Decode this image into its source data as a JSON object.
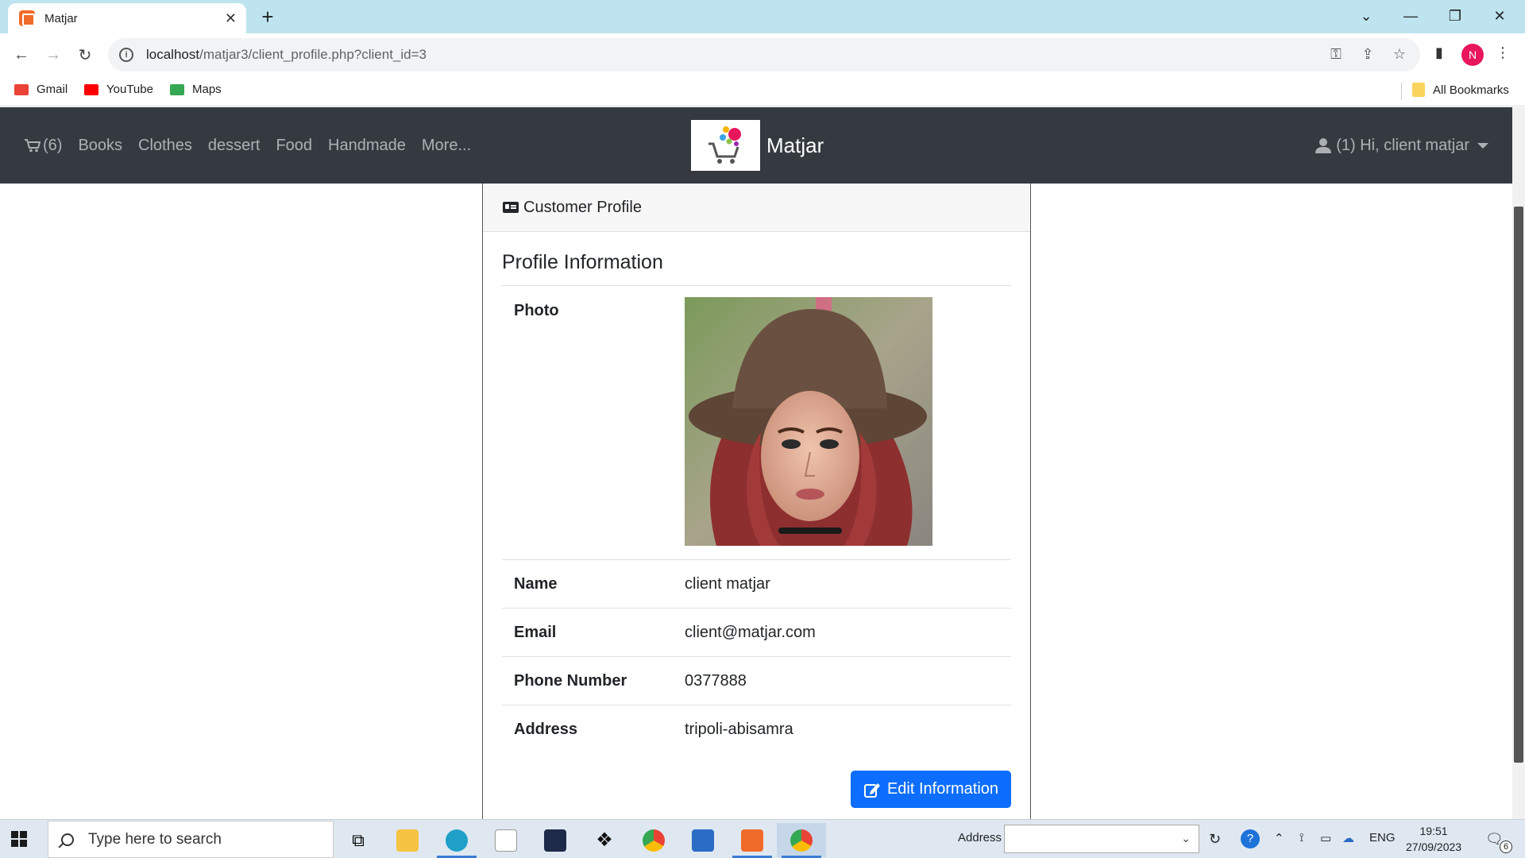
{
  "browser": {
    "tab_title": "Matjar",
    "url_host": "localhost",
    "url_path": "/matjar3/client_profile.php?client_id=3",
    "profile_initial": "N",
    "bookmarks": [
      {
        "label": "Gmail",
        "color": "#ea4335"
      },
      {
        "label": "YouTube",
        "color": "#ff0000"
      },
      {
        "label": "Maps",
        "color": "#34a853"
      }
    ],
    "all_bookmarks": "All Bookmarks"
  },
  "site": {
    "cart_count": "(6)",
    "nav_links": [
      "Books",
      "Clothes",
      "dessert",
      "Food",
      "Handmade",
      "More..."
    ],
    "brand_name": "Matjar",
    "user_menu": "(1) Hi, client matjar",
    "navbar_color": "#343a40"
  },
  "profile": {
    "card_header": "Customer Profile",
    "section_title": "Profile Information",
    "photo_label": "Photo",
    "fields": [
      {
        "label": "Name",
        "value": "client matjar"
      },
      {
        "label": "Email",
        "value": "client@matjar.com"
      },
      {
        "label": "Phone Number",
        "value": "0377888"
      },
      {
        "label": "Address",
        "value": "tripoli-abisamra"
      }
    ],
    "edit_button": "Edit Information",
    "button_color": "#0d6efd"
  },
  "taskbar": {
    "search_placeholder": "Type here to search",
    "address_label": "Address",
    "language": "ENG",
    "time": "19:51",
    "date": "27/09/2023",
    "notification_count": "6"
  }
}
